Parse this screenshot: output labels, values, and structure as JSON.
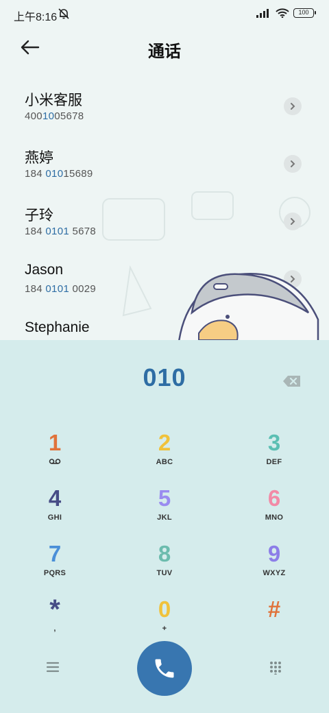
{
  "status_bar": {
    "time": "上午8:16",
    "battery": "100"
  },
  "header": {
    "title": "通话"
  },
  "contacts": [
    {
      "name": "小米客服",
      "number_pre": "400",
      "number_match": "10",
      "number_post": "05678"
    },
    {
      "name": "燕婷",
      "number_pre": "184 ",
      "number_match": "010",
      "number_post": "15689"
    },
    {
      "name": "子玲",
      "number_pre": "184 ",
      "number_match": "0101",
      "number_post": " 5678"
    },
    {
      "name": "Jason",
      "number_pre": "184 ",
      "number_match": "0101",
      "number_post": " 0029"
    },
    {
      "name": "Stephanie",
      "number_pre": "",
      "number_match": "",
      "number_post": ""
    }
  ],
  "dialer": {
    "entered": "010"
  },
  "keys": [
    {
      "digit": "1",
      "letters": "voicemail-icon",
      "color": "#e0733b"
    },
    {
      "digit": "2",
      "letters": "ABC",
      "color": "#f0c23b"
    },
    {
      "digit": "3",
      "letters": "DEF",
      "color": "#5bbfb3"
    },
    {
      "digit": "4",
      "letters": "GHI",
      "color": "#474d86"
    },
    {
      "digit": "5",
      "letters": "JKL",
      "color": "#9a8cf0"
    },
    {
      "digit": "6",
      "letters": "MNO",
      "color": "#f28aa6"
    },
    {
      "digit": "7",
      "letters": "PQRS",
      "color": "#4a8fd8"
    },
    {
      "digit": "8",
      "letters": "TUV",
      "color": "#6cbcae"
    },
    {
      "digit": "9",
      "letters": "WXYZ",
      "color": "#8c7ee8"
    },
    {
      "digit": "*",
      "letters": ",",
      "color": "#474d86"
    },
    {
      "digit": "0",
      "letters": "+",
      "color": "#f0c23b"
    },
    {
      "digit": "#",
      "letters": "",
      "color": "#e0733b"
    }
  ],
  "icons": {
    "back": "back-arrow-icon",
    "mute": "bell-off-icon",
    "signal": "signal-icon",
    "wifi": "wifi-icon",
    "chevron": "chevron-right-icon",
    "backspace": "backspace-icon",
    "menu": "menu-icon",
    "call": "phone-icon",
    "dialpad": "dialpad-icon"
  },
  "colors": {
    "accent": "#2e6da4",
    "call_button": "#3876b0",
    "keypad_bg": "#d5ecec"
  }
}
